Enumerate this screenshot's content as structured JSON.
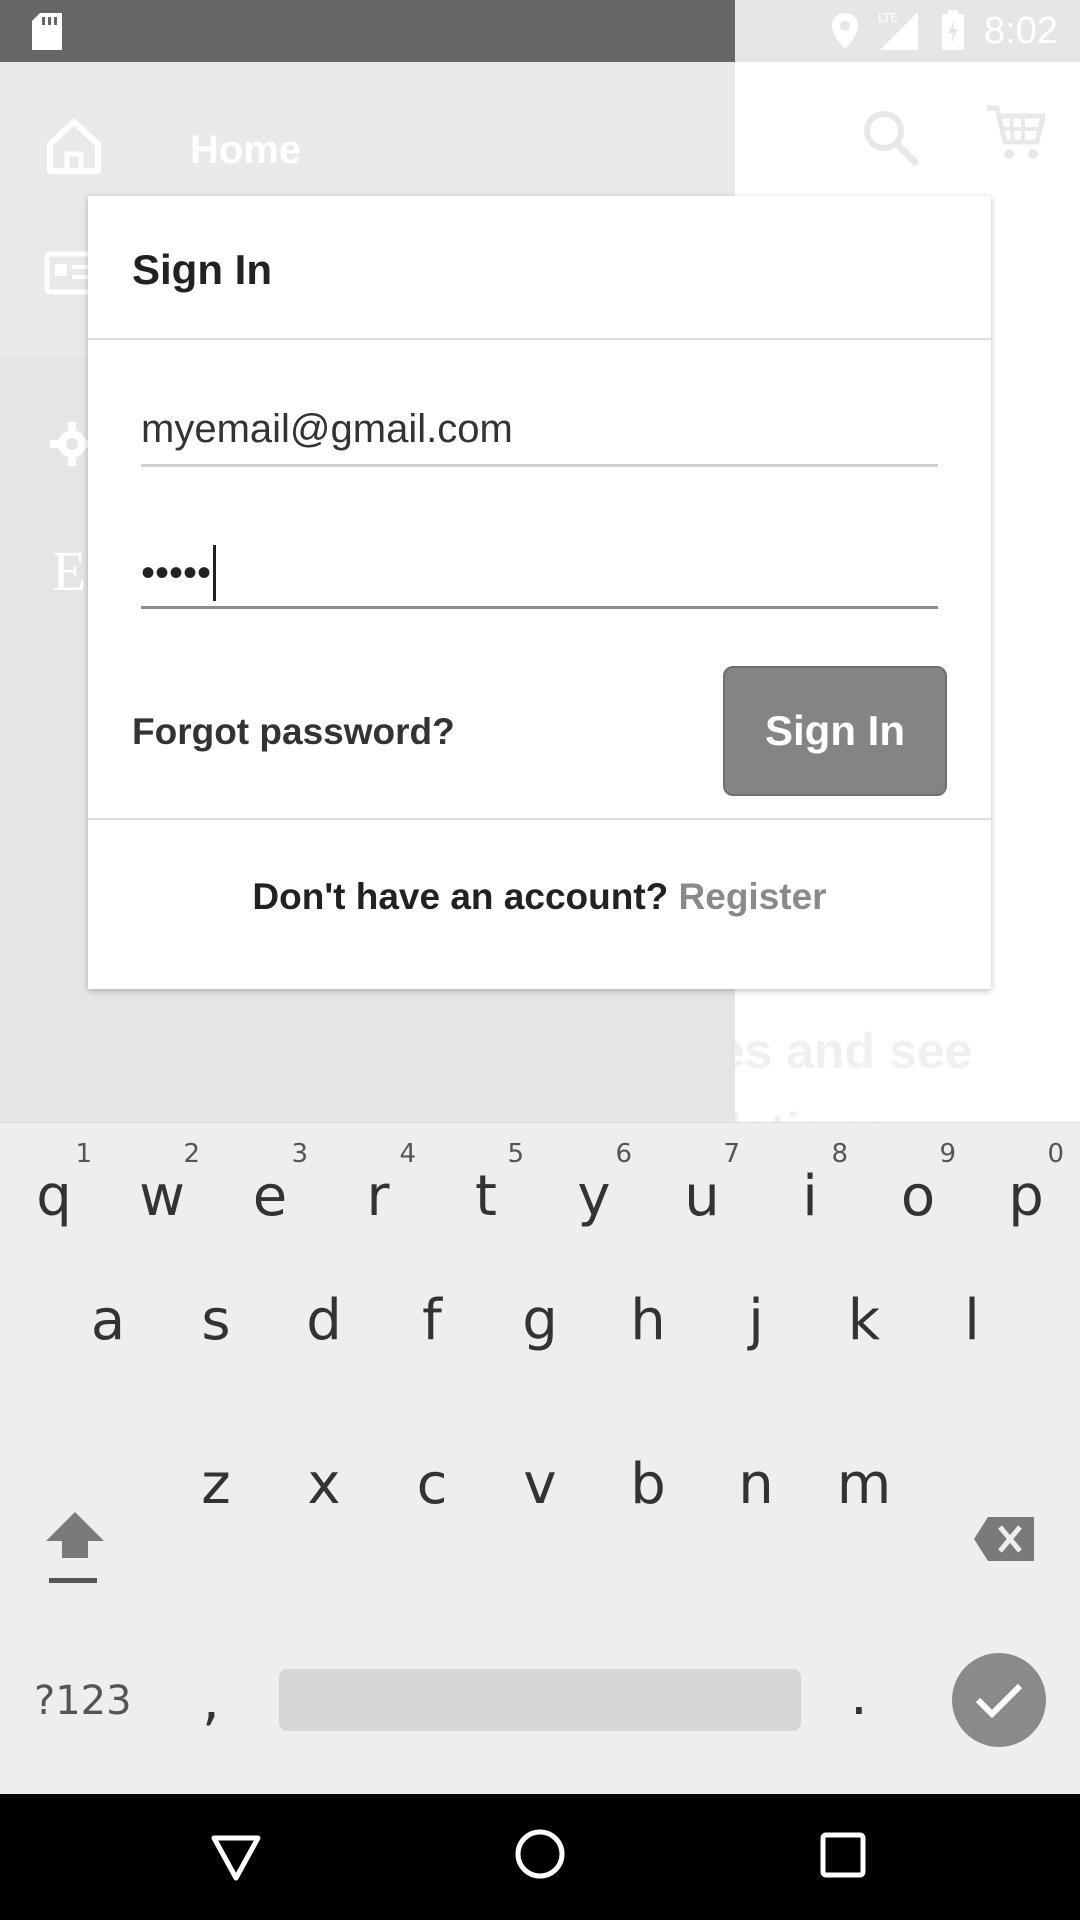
{
  "status_bar": {
    "time": "8:02",
    "network": "LTE"
  },
  "drawer": {
    "home_label": "Home",
    "partial_letter": "E"
  },
  "background": {
    "partial_text_1": "tes and see",
    "partial_text_2": "elations"
  },
  "dialog": {
    "title": "Sign In",
    "email_value": "myemail@gmail.com",
    "password_value": "•••••",
    "forgot_label": "Forgot password?",
    "signin_button": "Sign In",
    "footer_text": "Don't have an account?",
    "register_link": "Register"
  },
  "keyboard": {
    "row1": [
      {
        "key": "q",
        "hint": "1"
      },
      {
        "key": "w",
        "hint": "2"
      },
      {
        "key": "e",
        "hint": "3"
      },
      {
        "key": "r",
        "hint": "4"
      },
      {
        "key": "t",
        "hint": "5"
      },
      {
        "key": "y",
        "hint": "6"
      },
      {
        "key": "u",
        "hint": "7"
      },
      {
        "key": "i",
        "hint": "8"
      },
      {
        "key": "o",
        "hint": "9"
      },
      {
        "key": "p",
        "hint": "0"
      }
    ],
    "row2": [
      "a",
      "s",
      "d",
      "f",
      "g",
      "h",
      "j",
      "k",
      "l"
    ],
    "row3": [
      "z",
      "x",
      "c",
      "v",
      "b",
      "n",
      "m"
    ],
    "symbols_label": "?123",
    "comma": ",",
    "period": "."
  },
  "colors": {
    "status_bar_dark": "#666666",
    "drawer_bg": "#e5e5e5",
    "button_gray": "#848484",
    "register_gray": "#8a8a8a",
    "keyboard_bg": "#eeeeee",
    "nav_bg": "#000000"
  },
  "icons": {
    "status_left": "sd-card-icon",
    "status_right": [
      "location-icon",
      "signal-icon",
      "battery-charging-icon"
    ],
    "toolbar": [
      "search-icon",
      "cart-icon"
    ],
    "drawer": [
      "home-icon",
      "id-card-icon",
      "gear-icon"
    ],
    "keyboard": [
      "shift-icon",
      "backspace-icon",
      "checkmark-icon"
    ],
    "nav": [
      "back-icon",
      "home-circle-icon",
      "recents-icon"
    ]
  }
}
